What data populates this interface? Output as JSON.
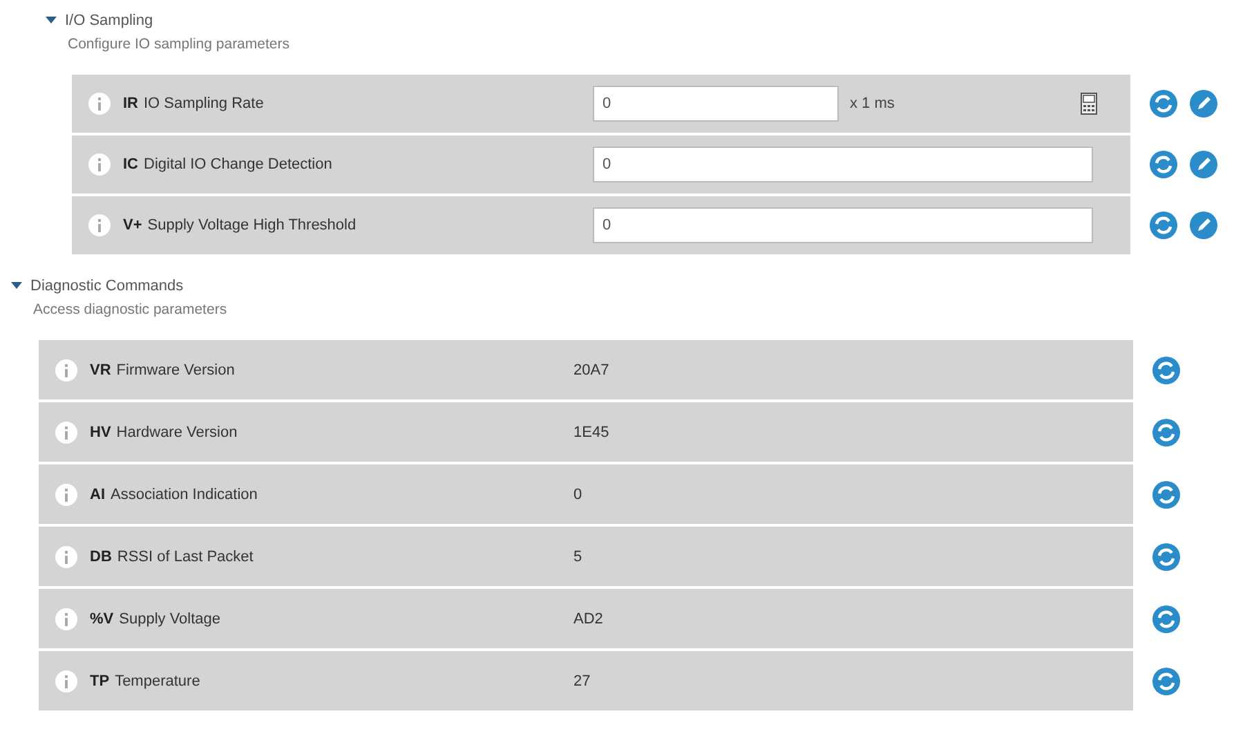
{
  "sections": [
    {
      "title": "I/O Sampling",
      "description": "Configure IO sampling parameters",
      "expanded": true,
      "rows": [
        {
          "kind": "editable",
          "code": "IR",
          "label": "IO Sampling Rate",
          "value": "0",
          "unit": "x 1 ms",
          "calculator": true
        },
        {
          "kind": "editable",
          "code": "IC",
          "label": "Digital IO Change Detection",
          "value": "0",
          "calculator": false
        },
        {
          "kind": "editable",
          "code": "V+",
          "label": "Supply Voltage High Threshold",
          "value": "0",
          "calculator": false
        }
      ]
    },
    {
      "title": "Diagnostic Commands",
      "description": "Access diagnostic parameters",
      "expanded": true,
      "rows": [
        {
          "kind": "readonly",
          "code": "VR",
          "label": "Firmware Version",
          "value": "20A7"
        },
        {
          "kind": "readonly",
          "code": "HV",
          "label": "Hardware Version",
          "value": "1E45"
        },
        {
          "kind": "readonly",
          "code": "AI",
          "label": "Association Indication",
          "value": "0"
        },
        {
          "kind": "readonly",
          "code": "DB",
          "label": "RSSI of Last Packet",
          "value": "5"
        },
        {
          "kind": "readonly",
          "code": "%V",
          "label": "Supply Voltage",
          "value": "AD2"
        },
        {
          "kind": "readonly",
          "code": "TP",
          "label": "Temperature",
          "value": "27"
        }
      ]
    }
  ]
}
